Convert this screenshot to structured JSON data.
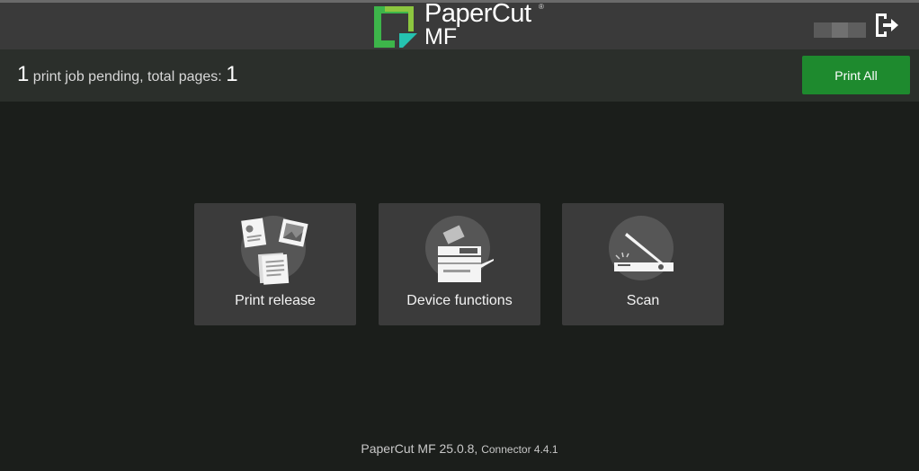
{
  "header": {
    "logo_line1": "PaperCut",
    "logo_tm": "®",
    "logo_line2": "MF",
    "logo_color": "#3db54a"
  },
  "status": {
    "job_count": "1",
    "job_text": " print job pending, total pages: ",
    "page_count": "1",
    "print_all_label": "Print All",
    "print_all_color": "#1e8a2e"
  },
  "tiles": [
    {
      "label": "Print release",
      "icon": "print-release-icon"
    },
    {
      "label": "Device functions",
      "icon": "copier-icon"
    },
    {
      "label": "Scan",
      "icon": "scanner-icon"
    }
  ],
  "footer": {
    "version": "PaperCut MF 25.0.8,",
    "connector": "Connector 4.4.1"
  }
}
